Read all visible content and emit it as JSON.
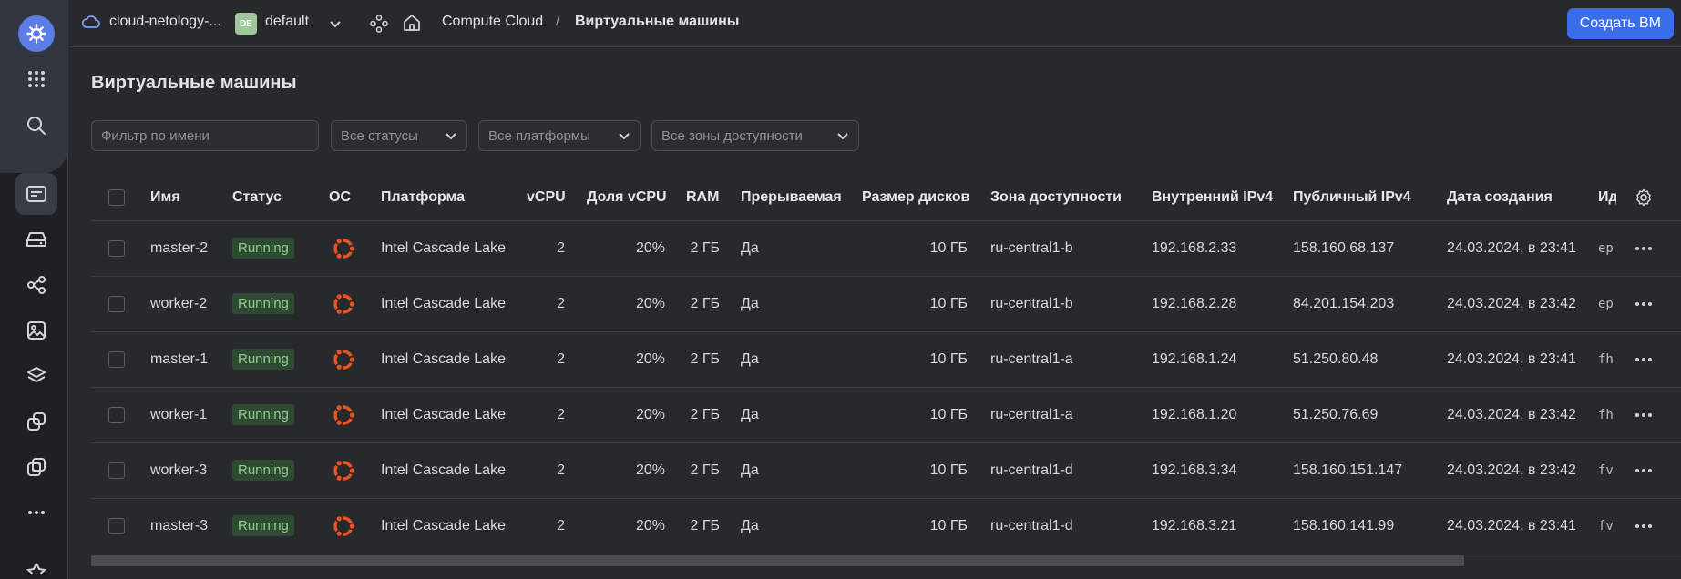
{
  "header": {
    "cloud_name": "cloud-netology-...",
    "folder_badge": "DE",
    "folder_name": "default",
    "service": "Compute Cloud",
    "separator": "/",
    "current_page": "Виртуальные машины",
    "create_button": "Создать ВМ"
  },
  "page": {
    "title": "Виртуальные машины"
  },
  "filters": {
    "name_placeholder": "Фильтр по имени",
    "status": "Все статусы",
    "platform": "Все платформы",
    "zone": "Все зоны доступности"
  },
  "table": {
    "columns": {
      "name": "Имя",
      "status": "Статус",
      "os": "ОС",
      "platform": "Платформа",
      "vcpu": "vCPU",
      "vcpu_share": "Доля vCPU",
      "ram": "RAM",
      "preemptible": "Прерываемая",
      "disk_size": "Размер дисков",
      "zone": "Зона доступности",
      "internal_ip": "Внутренний IPv4",
      "public_ip": "Публичный IPv4",
      "created": "Дата создания",
      "id": "Ид"
    },
    "rows": [
      {
        "name": "master-2",
        "status": "Running",
        "platform": "Intel Cascade Lake",
        "vcpu": "2",
        "vcpu_share": "20%",
        "ram": "2 ГБ",
        "preemptible": "Да",
        "disk_size": "10 ГБ",
        "zone": "ru-central1-b",
        "internal_ip": "192.168.2.33",
        "public_ip": "158.160.68.137",
        "created": "24.03.2024, в 23:41",
        "id": "ep"
      },
      {
        "name": "worker-2",
        "status": "Running",
        "platform": "Intel Cascade Lake",
        "vcpu": "2",
        "vcpu_share": "20%",
        "ram": "2 ГБ",
        "preemptible": "Да",
        "disk_size": "10 ГБ",
        "zone": "ru-central1-b",
        "internal_ip": "192.168.2.28",
        "public_ip": "84.201.154.203",
        "created": "24.03.2024, в 23:42",
        "id": "ep"
      },
      {
        "name": "master-1",
        "status": "Running",
        "platform": "Intel Cascade Lake",
        "vcpu": "2",
        "vcpu_share": "20%",
        "ram": "2 ГБ",
        "preemptible": "Да",
        "disk_size": "10 ГБ",
        "zone": "ru-central1-a",
        "internal_ip": "192.168.1.24",
        "public_ip": "51.250.80.48",
        "created": "24.03.2024, в 23:41",
        "id": "fh"
      },
      {
        "name": "worker-1",
        "status": "Running",
        "platform": "Intel Cascade Lake",
        "vcpu": "2",
        "vcpu_share": "20%",
        "ram": "2 ГБ",
        "preemptible": "Да",
        "disk_size": "10 ГБ",
        "zone": "ru-central1-a",
        "internal_ip": "192.168.1.20",
        "public_ip": "51.250.76.69",
        "created": "24.03.2024, в 23:42",
        "id": "fh"
      },
      {
        "name": "worker-3",
        "status": "Running",
        "platform": "Intel Cascade Lake",
        "vcpu": "2",
        "vcpu_share": "20%",
        "ram": "2 ГБ",
        "preemptible": "Да",
        "disk_size": "10 ГБ",
        "zone": "ru-central1-d",
        "internal_ip": "192.168.3.34",
        "public_ip": "158.160.151.147",
        "created": "24.03.2024, в 23:42",
        "id": "fv"
      },
      {
        "name": "master-3",
        "status": "Running",
        "platform": "Intel Cascade Lake",
        "vcpu": "2",
        "vcpu_share": "20%",
        "ram": "2 ГБ",
        "preemptible": "Да",
        "disk_size": "10 ГБ",
        "zone": "ru-central1-d",
        "internal_ip": "192.168.3.21",
        "public_ip": "158.160.141.99",
        "created": "24.03.2024, в 23:41",
        "id": "fv"
      }
    ]
  },
  "icons": {
    "os": "ubuntu-icon",
    "row_menu": "more-horizontal-icon",
    "settings": "gear-icon"
  },
  "colors": {
    "accent": "#3a6ee8",
    "running_badge_bg": "#2f4a33",
    "running_badge_text": "#8fd28a",
    "ubuntu_orange": "#e95420"
  }
}
